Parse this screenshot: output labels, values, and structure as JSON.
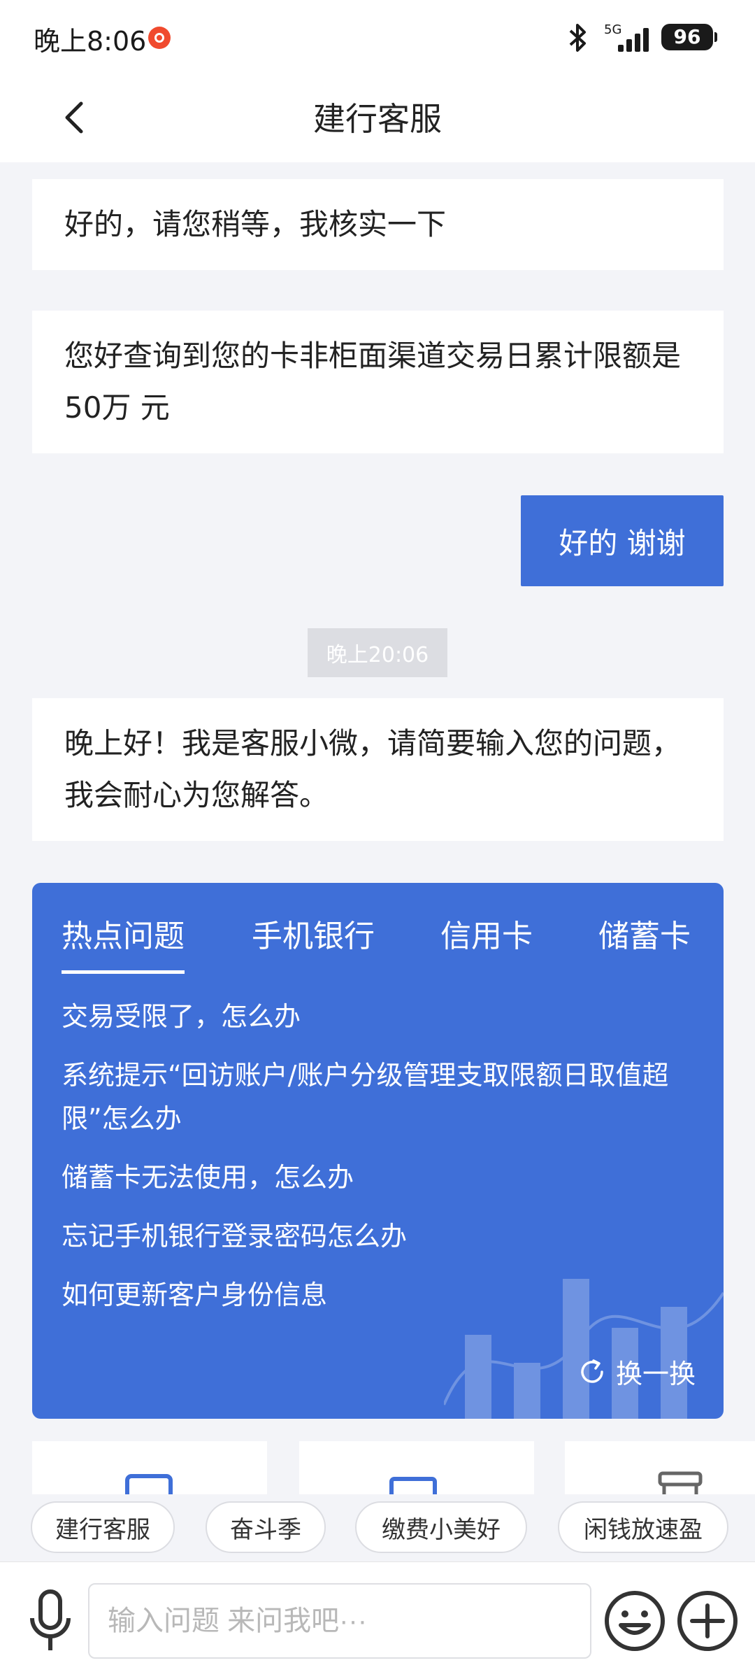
{
  "status_bar": {
    "time": "晚上8:06",
    "network": "5G",
    "battery": "96",
    "icons": [
      "notification-badge-icon",
      "bluetooth-icon",
      "signal-icon",
      "battery-icon"
    ]
  },
  "header": {
    "title": "建行客服",
    "back_icon": "chevron-left-icon"
  },
  "messages": [
    {
      "from": "agent",
      "text": "好的，请您稍等，我核实一下"
    },
    {
      "from": "agent",
      "text": "您好查询到您的卡非柜面渠道交易日累计限额是 50万 元"
    },
    {
      "from": "user",
      "text": "好的 谢谢"
    },
    {
      "from": "system",
      "text": "晚上20:06"
    },
    {
      "from": "agent",
      "text": "晚上好！我是客服小微，请简要输入您的问题，我会耐心为您解答。"
    }
  ],
  "faq": {
    "tabs": [
      {
        "label": "热点问题",
        "active": true
      },
      {
        "label": "手机银行",
        "active": false
      },
      {
        "label": "信用卡",
        "active": false
      },
      {
        "label": "储蓄卡",
        "active": false
      }
    ],
    "items": [
      "交易受限了，怎么办",
      "系统提示“回访账户/账户分级管理支取限额日取值超限”怎么办",
      "储蓄卡无法使用，怎么办",
      "忘记手机银行登录密码怎么办",
      "如何更新客户身份信息"
    ],
    "refresh_label": "换一换",
    "refresh_icon": "refresh-icon"
  },
  "quick_chips": [
    "建行客服",
    "奋斗季",
    "缴费小美好",
    "闲钱放速盈"
  ],
  "input": {
    "placeholder": "输入问题 来问我吧···",
    "mic_icon": "microphone-icon",
    "emoji_icon": "emoji-icon",
    "plus_icon": "plus-icon"
  },
  "colors": {
    "accent": "#3f6fd8",
    "background": "#f3f4f8",
    "timestamp_bg": "#dcdde2"
  }
}
